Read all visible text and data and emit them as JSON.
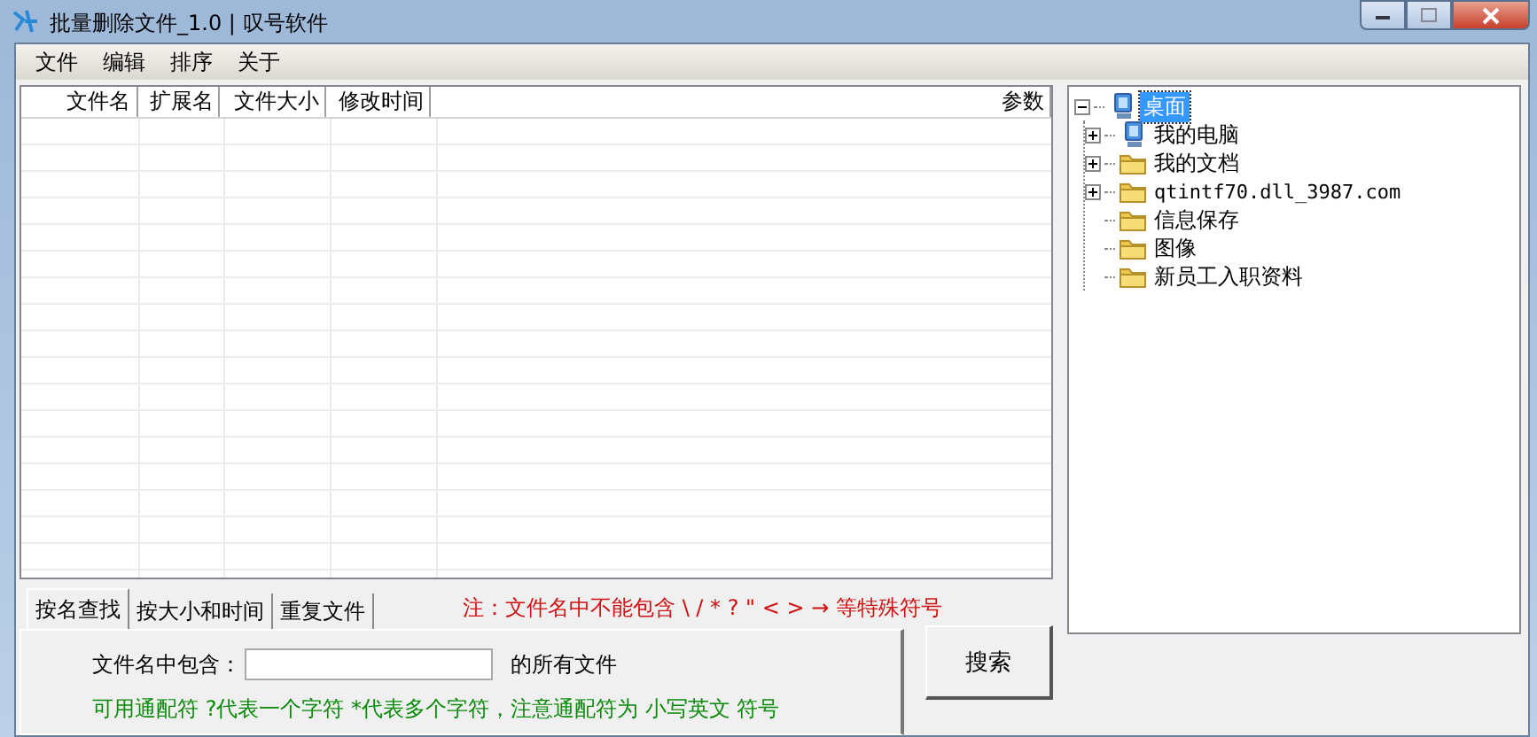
{
  "window": {
    "title": "批量删除文件_1.0 | 叹号软件"
  },
  "menu": [
    "文件",
    "编辑",
    "排序",
    "关于"
  ],
  "file_list": {
    "columns": [
      "文件名",
      "扩展名",
      "文件大小",
      "修改时间",
      "参数"
    ]
  },
  "tree": {
    "label": "桌面",
    "kind": "computer",
    "expanded": true,
    "selected": true,
    "children": [
      {
        "label": "我的电脑",
        "kind": "computer",
        "expanded": false,
        "selected": false
      },
      {
        "label": "我的文档",
        "kind": "folder",
        "expanded": false,
        "selected": false
      },
      {
        "label": "qtintf70.dll_3987.com",
        "kind": "folder",
        "expanded": false,
        "selected": false
      },
      {
        "label": "信息保存",
        "kind": "folder",
        "selected": false
      },
      {
        "label": "图像",
        "kind": "folder",
        "selected": false
      },
      {
        "label": "新员工入职资料",
        "kind": "folder",
        "selected": false
      }
    ]
  },
  "tabs": [
    {
      "label": "按名查找",
      "selected": true
    },
    {
      "label": "按大小和时间",
      "selected": false
    },
    {
      "label": "重复文件",
      "selected": false
    }
  ],
  "note": "注：文件名中不能包含 \\ /  * ? \" < > → 等特殊符号",
  "search": {
    "label": "文件名中包含：",
    "suffix": "的所有文件",
    "hint": "可用通配符 ?代表一个字符 *代表多个字符，注意通配符为 小写英文 符号"
  },
  "search_button": "搜索"
}
